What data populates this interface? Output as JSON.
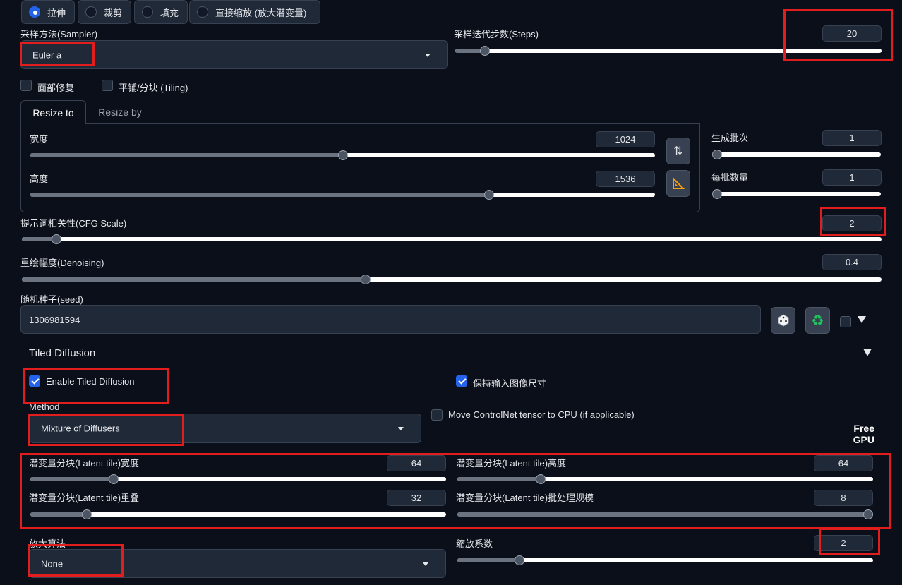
{
  "resize_mode": {
    "options": [
      {
        "label": "拉伸",
        "selected": true
      },
      {
        "label": "裁剪",
        "selected": false
      },
      {
        "label": "填充",
        "selected": false
      },
      {
        "label": "直接缩放 (放大潜变量)",
        "selected": false
      }
    ]
  },
  "sampler": {
    "label": "采样方法(Sampler)",
    "value": "Euler a"
  },
  "steps": {
    "label": "采样迭代步数(Steps)",
    "value": "20",
    "fraction": 0.07
  },
  "options": {
    "face_restore": {
      "label": "面部修复",
      "checked": false
    },
    "tiling": {
      "label": "平铺/分块 (Tiling)",
      "checked": false
    }
  },
  "resize_tabs": [
    {
      "label": "Resize to",
      "active": true
    },
    {
      "label": "Resize by",
      "active": false
    }
  ],
  "width": {
    "label": "宽度",
    "value": "1024",
    "fraction": 0.5
  },
  "height": {
    "label": "高度",
    "value": "1536",
    "fraction": 0.735
  },
  "swap_icon": "swap-dimensions-icon",
  "ratio_icon": "triangle-ruler-icon",
  "batch_count": {
    "label": "生成批次",
    "value": "1",
    "fraction": 0.0
  },
  "batch_size": {
    "label": "每批数量",
    "value": "1",
    "fraction": 0.0
  },
  "cfg": {
    "label": "提示词相关性(CFG Scale)",
    "value": "2",
    "fraction": 0.04
  },
  "denoising": {
    "label": "重绘幅度(Denoising)",
    "value": "0.4",
    "fraction": 0.4
  },
  "seed": {
    "label": "随机种子(seed)",
    "value": "1306981594",
    "dice_icon": "dice-icon",
    "recycle_icon": "recycle-icon"
  },
  "tiled": {
    "title": "Tiled Diffusion",
    "enable": {
      "label": "Enable Tiled Diffusion",
      "checked": true
    },
    "keep_size": {
      "label": "保持输入图像尺寸",
      "checked": true
    },
    "method": {
      "label": "Method",
      "value": "Mixture of Diffusers"
    },
    "move_cn": {
      "label": "Move ControlNet tensor to CPU (if applicable)",
      "checked": false
    },
    "free_gpu": "Free GPU",
    "tile_width": {
      "label": "潜变量分块(Latent tile)宽度",
      "value": "64",
      "fraction": 0.2
    },
    "tile_height": {
      "label": "潜变量分块(Latent tile)高度",
      "value": "64",
      "fraction": 0.2
    },
    "tile_overlap": {
      "label": "潜变量分块(Latent tile)重叠",
      "value": "32",
      "fraction": 0.135
    },
    "tile_batch": {
      "label": "潜变量分块(Latent tile)批处理规模",
      "value": "8",
      "fraction": 1.0
    },
    "upscaler": {
      "label": "放大算法",
      "value": "None"
    },
    "scale": {
      "label": "缩放系数",
      "value": "2",
      "fraction": 0.15
    }
  },
  "colors": {
    "accent": "#2563eb",
    "highlight": "#e11d1d",
    "background": "#0b0f19"
  }
}
